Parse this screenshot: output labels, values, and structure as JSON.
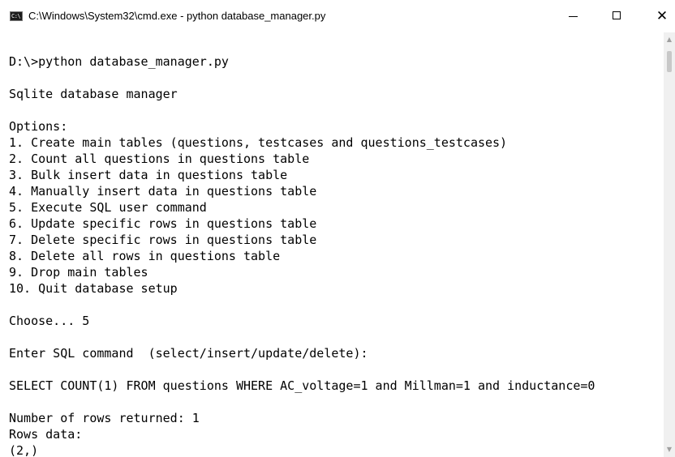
{
  "window": {
    "title": "C:\\Windows\\System32\\cmd.exe - python  database_manager.py",
    "icon": "cmd-icon",
    "icon_glyph": "C:\\",
    "controls": {
      "minimize_icon": "minimize-icon",
      "maximize_icon": "maximize-icon",
      "close_glyph": "✕"
    }
  },
  "console": {
    "lines": [
      "D:\\>python database_manager.py",
      "",
      "Sqlite database manager",
      "",
      "Options:",
      "1. Create main tables (questions, testcases and questions_testcases)",
      "2. Count all questions in questions table",
      "3. Bulk insert data in questions table",
      "4. Manually insert data in questions table",
      "5. Execute SQL user command",
      "6. Update specific rows in questions table",
      "7. Delete specific rows in questions table",
      "8. Delete all rows in questions table",
      "9. Drop main tables",
      "10. Quit database setup",
      "",
      "Choose... 5",
      "",
      "Enter SQL command  (select/insert/update/delete):",
      "",
      "SELECT COUNT(1) FROM questions WHERE AC_voltage=1 and Millman=1 and inductance=0",
      "",
      "Number of rows returned: 1",
      "Rows data:",
      "(2,)"
    ]
  },
  "scrollbar": {
    "up_glyph": "▲",
    "down_glyph": "▼"
  },
  "colors": {
    "background": "#ffffff",
    "text": "#000000",
    "scrollbar_track": "#f0f0f0",
    "scrollbar_thumb": "#c8c8c8"
  }
}
